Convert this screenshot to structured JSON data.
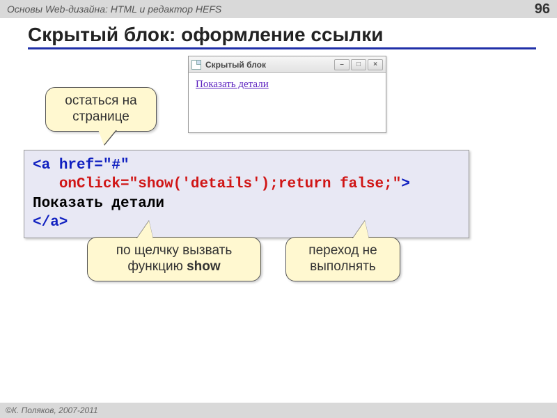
{
  "header": {
    "course": "Основы Web-дизайна: HTML и редактор HEFS",
    "page_number": "96"
  },
  "title": "Скрытый блок: оформление ссылки",
  "browser": {
    "tab_title": "Скрытый блок",
    "link_text": "Показать детали"
  },
  "callouts": {
    "stay": "остаться на странице",
    "call_show_1": "по щелчку вызвать",
    "call_show_2": "функцию ",
    "call_show_bold": "show",
    "no_nav": "переход не выполнять"
  },
  "code": {
    "l1a": "<a ",
    "l1b": "href=\"#\"",
    "l2_indent": "   ",
    "l2_attr": "onClick=\"show('details');return false;\"",
    "l2_end": ">",
    "l3": "Показать детали",
    "l4": "</a>"
  },
  "footer": {
    "copyright": "© ",
    "author": "К. Поляков, 2007-2011"
  }
}
